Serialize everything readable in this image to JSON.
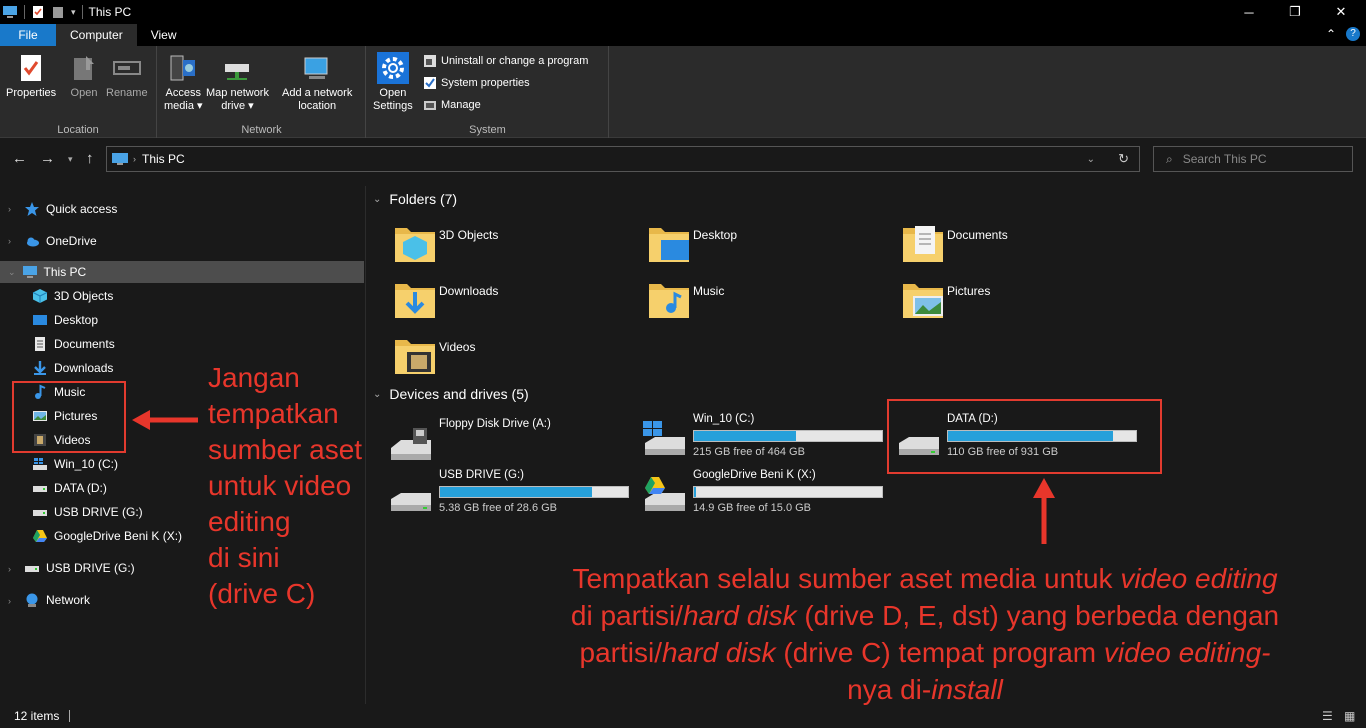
{
  "window": {
    "title": "This PC",
    "minimize": "─",
    "maximize": "❐",
    "close": "✕"
  },
  "ribbon": {
    "tabs": [
      "File",
      "Computer",
      "View"
    ],
    "active_tab": "Computer",
    "location": {
      "label": "Location",
      "buttons": [
        "Properties",
        "Open",
        "Rename"
      ]
    },
    "network": {
      "label": "Network",
      "access_media": [
        "Access",
        "media ▾"
      ],
      "map_drive": [
        "Map network",
        "drive ▾"
      ],
      "add_location": [
        "Add a network",
        "location"
      ]
    },
    "system": {
      "label": "System",
      "open_settings": [
        "Open",
        "Settings"
      ],
      "uninstall": "Uninstall or change a program",
      "system_properties": "System properties",
      "manage": "Manage"
    }
  },
  "address": {
    "path": "This PC",
    "search_placeholder": "Search This PC"
  },
  "nav": {
    "quick_access": "Quick access",
    "onedrive": "OneDrive",
    "this_pc": "This PC",
    "children": [
      "3D Objects",
      "Desktop",
      "Documents",
      "Downloads",
      "Music",
      "Pictures",
      "Videos",
      "Win_10 (C:)",
      "DATA (D:)",
      "USB DRIVE (G:)",
      "GoogleDrive Beni K (X:)"
    ],
    "usb_drive": "USB DRIVE (G:)",
    "network": "Network"
  },
  "content": {
    "folders_header": "Folders (7)",
    "folders": [
      "3D Objects",
      "Desktop",
      "Documents",
      "Downloads",
      "Music",
      "Pictures",
      "Videos"
    ],
    "drives_header": "Devices and drives (5)",
    "drives": [
      {
        "name": "Floppy Disk Drive (A:)",
        "free": "",
        "used_pct": null
      },
      {
        "name": "Win_10 (C:)",
        "free": "215 GB free of 464 GB",
        "used_pct": 54
      },
      {
        "name": "DATA (D:)",
        "free": "110 GB free of 931 GB",
        "used_pct": 88
      },
      {
        "name": "USB DRIVE (G:)",
        "free": "5.38 GB free of 28.6 GB",
        "used_pct": 81
      },
      {
        "name": "GoogleDrive Beni K (X:)",
        "free": "14.9 GB free of 15.0 GB",
        "used_pct": 1
      }
    ]
  },
  "status": {
    "items": "12 items"
  },
  "annotations": {
    "left": [
      "Jangan",
      "tempatkan",
      "sumber aset",
      "untuk video",
      "editing",
      "di sini",
      "(drive C)"
    ],
    "bottom": {
      "l1a": "Tempatkan selalu sumber aset media untuk ",
      "l1b": "video editing",
      "l2a": "di partisi/",
      "l2b": "hard disk",
      "l2c": " (drive D, E, dst) yang berbeda dengan",
      "l3a": "partisi/",
      "l3b": "hard disk",
      "l3c": " (drive C) tempat program ",
      "l3d": "video editing-",
      "l4a": "nya di-",
      "l4b": "install"
    },
    "colors": {
      "annotation": "#e8362b",
      "accent": "#1979ca",
      "drive_bar": "#26a0da"
    }
  }
}
